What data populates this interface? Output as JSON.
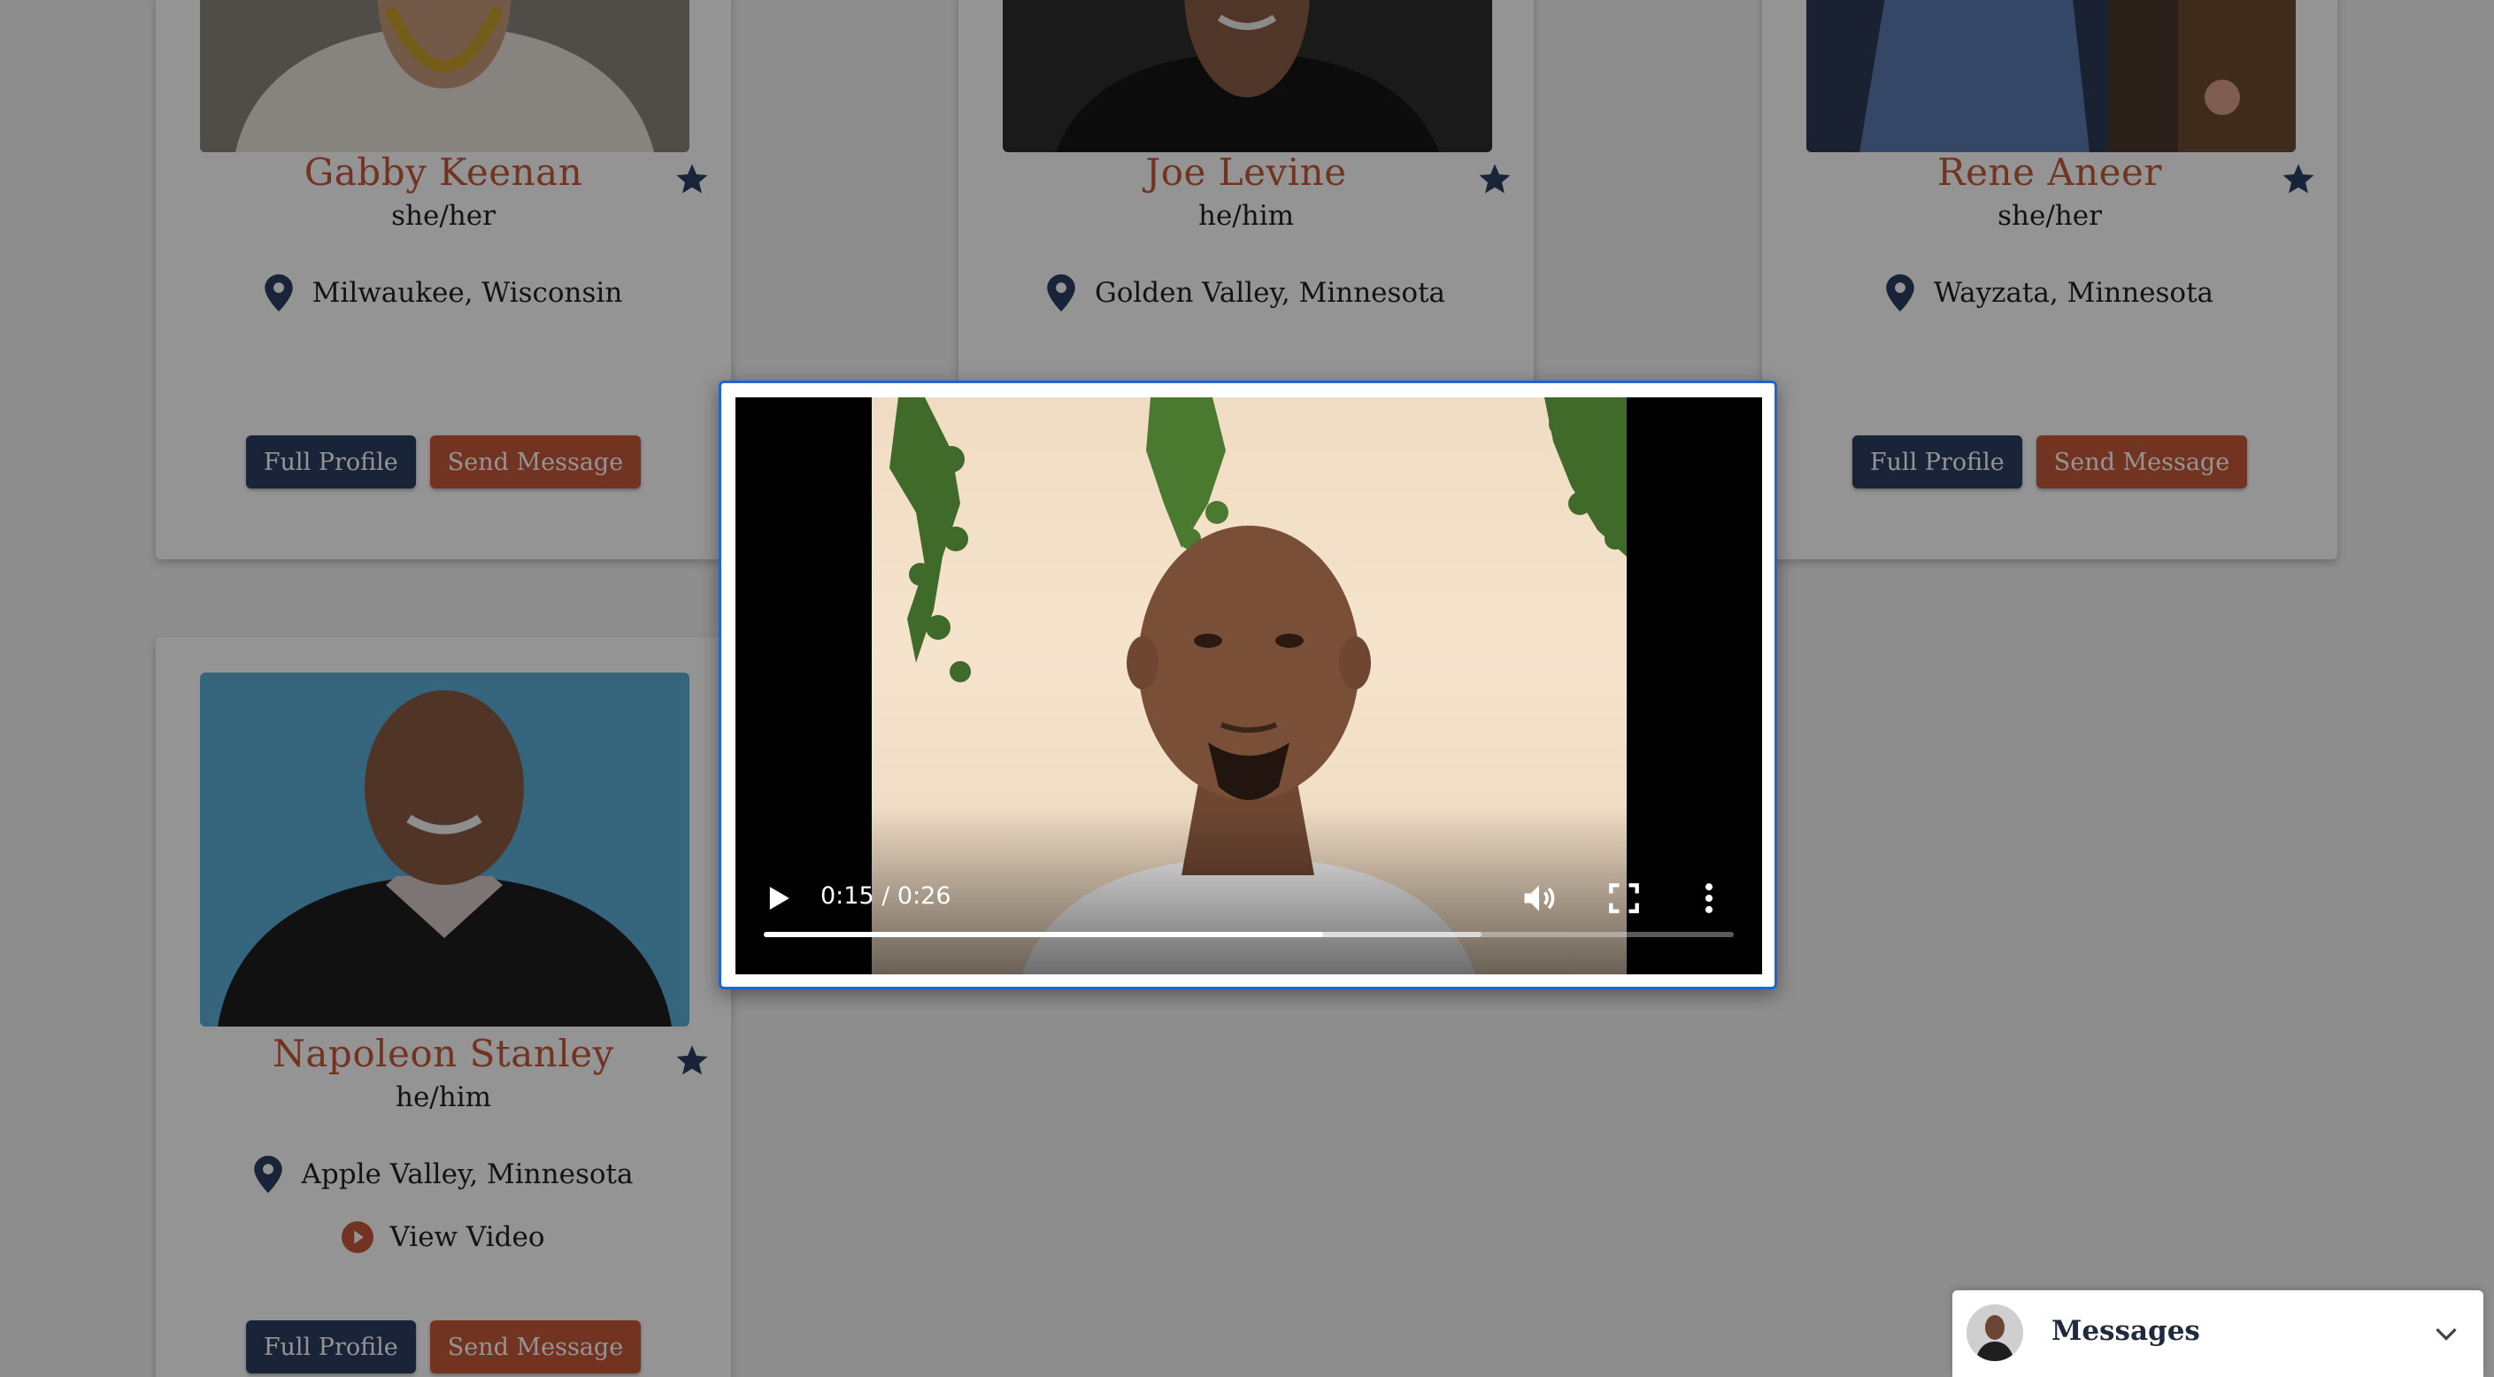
{
  "colors": {
    "accent": "#c4593a",
    "navy": "#2c3e63",
    "modal_border": "#1e66d0",
    "overlay": "rgba(0,0,0,0.42)"
  },
  "profiles": [
    {
      "name": "Gabby Keenan",
      "pronouns": "she/her",
      "location": "Milwaukee, Wisconsin",
      "full_profile_label": "Full Profile",
      "send_message_label": "Send Message"
    },
    {
      "name": "Joe Levine",
      "pronouns": "he/him",
      "location": "Golden Valley, Minnesota"
    },
    {
      "name": "Rene Aneer",
      "pronouns": "she/her",
      "location": "Wayzata, Minnesota",
      "full_profile_label": "Full Profile",
      "send_message_label": "Send Message"
    },
    {
      "name": "Napoleon Stanley",
      "pronouns": "he/him",
      "location": "Apple Valley, Minnesota",
      "video_label": "View Video",
      "full_profile_label": "Full Profile",
      "send_message_label": "Send Message"
    }
  ],
  "video_player": {
    "time_display": "0:15 / 0:26",
    "current_seconds": 15,
    "duration_seconds": 26,
    "buffered_fraction": 0.74,
    "icons": [
      "play-icon",
      "volume-icon",
      "fullscreen-icon",
      "more-options-icon"
    ]
  },
  "messages_bar": {
    "title": "Messages"
  }
}
